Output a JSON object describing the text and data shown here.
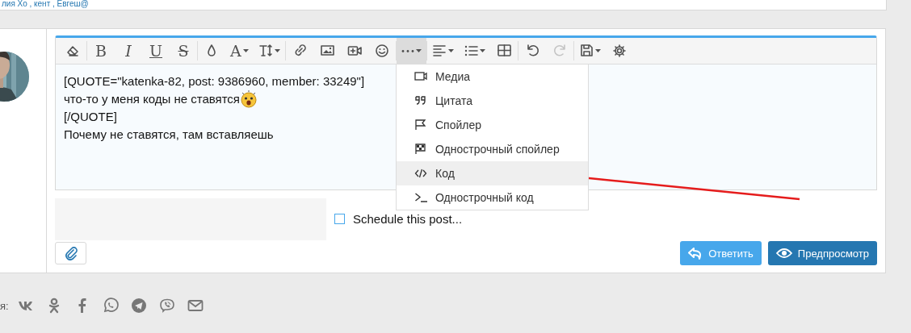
{
  "top_strip": {
    "text": "лия Хо , кент , Евгеш@"
  },
  "post": {
    "toolbar": {
      "groups": [
        [
          {
            "kind": "icon",
            "dropdown": false,
            "selected": false,
            "disabled": false
          }
        ],
        [
          {
            "kind": "bold",
            "label": "B",
            "dropdown": false,
            "selected": false,
            "disabled": false
          },
          {
            "kind": "italic",
            "label": "I",
            "dropdown": false,
            "selected": false,
            "disabled": false
          },
          {
            "kind": "underline",
            "label": "U",
            "dropdown": false,
            "selected": false,
            "disabled": false
          },
          {
            "kind": "strike",
            "label": "S",
            "dropdown": false,
            "selected": false,
            "disabled": false
          }
        ],
        [
          {
            "kind": "icon",
            "dropdown": false,
            "selected": false,
            "disabled": false
          },
          {
            "kind": "letter",
            "label": "A",
            "dropdown": true,
            "selected": false,
            "disabled": false
          },
          {
            "kind": "icon",
            "dropdown": true,
            "selected": false,
            "disabled": false
          }
        ],
        [
          {
            "kind": "icon",
            "dropdown": false,
            "selected": false,
            "disabled": false
          },
          {
            "kind": "icon",
            "dropdown": false,
            "selected": false,
            "disabled": false
          },
          {
            "kind": "icon",
            "dropdown": false,
            "selected": false,
            "disabled": false
          },
          {
            "kind": "icon",
            "dropdown": false,
            "selected": false,
            "disabled": false
          }
        ],
        [
          {
            "kind": "icon",
            "dropdown": true,
            "selected": true,
            "disabled": false
          }
        ],
        [
          {
            "kind": "icon",
            "dropdown": true,
            "selected": false,
            "disabled": false
          },
          {
            "kind": "icon",
            "dropdown": true,
            "selected": false,
            "disabled": false
          },
          {
            "kind": "icon",
            "dropdown": false,
            "selected": false,
            "disabled": false
          }
        ],
        [
          {
            "kind": "icon",
            "dropdown": false,
            "selected": false,
            "disabled": false
          },
          {
            "kind": "icon",
            "dropdown": false,
            "selected": false,
            "disabled": true
          }
        ],
        [
          {
            "kind": "icon",
            "dropdown": true,
            "selected": false,
            "disabled": false
          },
          {
            "kind": "icon",
            "dropdown": false,
            "selected": false,
            "disabled": false
          }
        ]
      ]
    },
    "editor_lines": [
      {
        "text": "[QUOTE=\"katenka-82, post: 9386960, member: 33249\"]",
        "smiley": false
      },
      {
        "text": "что-то у меня коды не ставятся",
        "smiley": true
      },
      {
        "text": "[/QUOTE]",
        "smiley": false
      },
      {
        "text": "Почему не ставятся, там вставляешь",
        "smiley": false
      }
    ],
    "insert_menu": [
      {
        "label": "Медиа",
        "selected": false
      },
      {
        "label": "Цитата",
        "selected": false
      },
      {
        "label": "Спойлер",
        "selected": false
      },
      {
        "label": "Однострочный спойлер",
        "selected": false
      },
      {
        "label": "Код",
        "selected": true
      },
      {
        "label": "Однострочный код",
        "selected": false
      }
    ],
    "schedule": {
      "label": "Schedule this post...",
      "checked": false
    },
    "buttons": [
      {
        "kind": "reply",
        "label": "Ответить"
      },
      {
        "kind": "preview",
        "label": "Предпросмотр"
      }
    ]
  },
  "share": {
    "label": "я:"
  }
}
